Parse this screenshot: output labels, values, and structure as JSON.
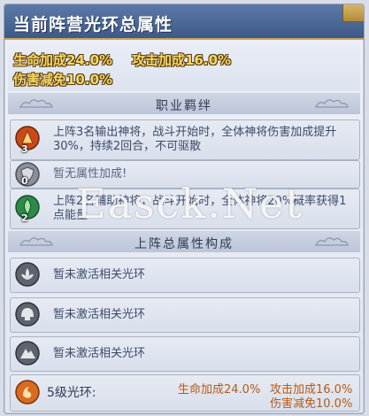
{
  "panel": {
    "title": "当前阵营光环总属性"
  },
  "totals": {
    "hp_bonus": "生命加成24.0%",
    "attack_bonus": "攻击加成16.0%",
    "damage_reduction": "伤害减免10.0%"
  },
  "career_bond": {
    "header": "职业羁绊",
    "items": [
      {
        "icon": "fire-emblem-icon",
        "count": "3",
        "text": "上阵3名输出神将，战斗开始时，全体神将伤害加成提升30%，持续2回合，不可驱散"
      },
      {
        "icon": "shield-emblem-icon",
        "count": "0",
        "text": "暂无属性加成!"
      },
      {
        "icon": "leaf-emblem-icon",
        "count": "2",
        "text": "上阵2名辅助神将，战斗开始时，全体神将20%概率获得1点能量"
      }
    ]
  },
  "lineup_attributes": {
    "header": "上阵总属性构成",
    "items": [
      {
        "icon": "lotus-emblem-icon",
        "text": "暂未激活相关光环"
      },
      {
        "icon": "helmet-emblem-icon",
        "text": "暂未激活相关光环"
      },
      {
        "icon": "mountain-emblem-icon",
        "text": "暂未激活相关光环"
      }
    ],
    "footer": {
      "label": "5级光环:",
      "hp_bonus": "生命加成24.0%",
      "attack_bonus": "攻击加成16.0%",
      "damage_reduction": "伤害减免10.0%"
    }
  },
  "watermark": "Easck.Net"
}
